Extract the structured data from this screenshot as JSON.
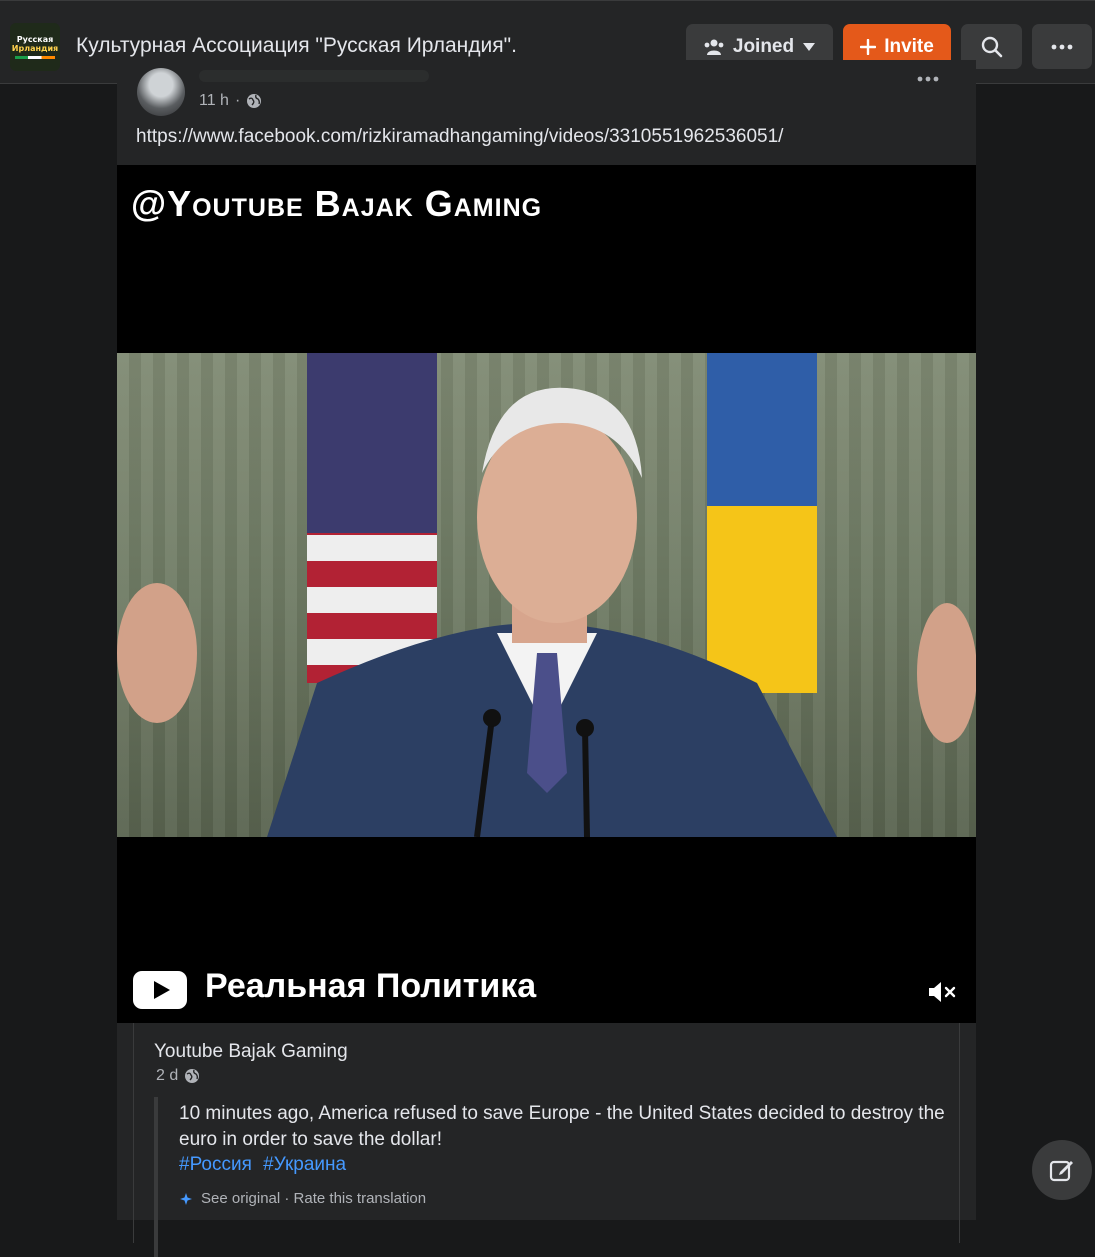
{
  "header": {
    "group_logo_line1": "Русская",
    "group_logo_line2": "Ирландия",
    "group_title": "Культурная Ассоциация \"Русская Ирландия\".",
    "joined_label": "Joined",
    "invite_label": "Invite",
    "icons": {
      "joined": "people-icon",
      "joined_caret": "caret-down-icon",
      "invite": "plus-icon",
      "search": "search-icon",
      "more": "more-horizontal-icon"
    }
  },
  "post": {
    "time": "11 h",
    "privacy_icon": "globe-icon",
    "more_icon": "more-horizontal-icon",
    "link_text": "https://www.facebook.com/rizkiramadhangaming/videos/3310551962536051/",
    "video": {
      "watermark": "@Youtube Bajak Gaming",
      "caption": "Реальная Политика",
      "brand_icon": "youtube-icon",
      "mute_icon": "muted-speaker-icon",
      "flag_left": "#b22234",
      "flag_right_top": "#2f5ea8",
      "flag_right_bottom": "#f5c518"
    },
    "shared": {
      "author": "Youtube Bajak Gaming",
      "time": "2 d",
      "text": "10 minutes ago, America refused to save Europe - the United States decided to destroy the euro in order to save the dollar!",
      "hashtags": [
        "#Россия",
        "#Украина"
      ],
      "translation_links": "See original · Rate this translation"
    }
  },
  "fab": {
    "icon": "compose-icon"
  },
  "colors": {
    "background": "#18191a",
    "surface": "#242526",
    "accent": "#e4591a",
    "link": "#4599ff"
  }
}
